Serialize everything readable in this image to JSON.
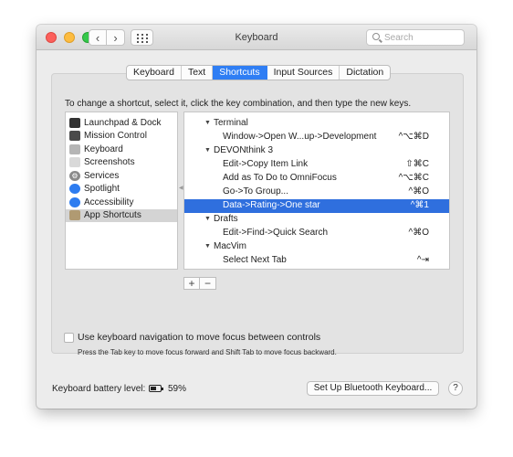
{
  "window": {
    "title": "Keyboard",
    "search_placeholder": "Search",
    "nav": {
      "back": "‹",
      "forward": "›"
    }
  },
  "tabs": [
    {
      "label": "Keyboard",
      "active": false
    },
    {
      "label": "Text",
      "active": false
    },
    {
      "label": "Shortcuts",
      "active": true
    },
    {
      "label": "Input Sources",
      "active": false
    },
    {
      "label": "Dictation",
      "active": false
    }
  ],
  "instruction": "To change a shortcut, select it, click the key combination, and then type the new keys.",
  "categories": [
    {
      "label": "Launchpad & Dock",
      "icon": "launchpad-icon",
      "color": "#333333"
    },
    {
      "label": "Mission Control",
      "icon": "mission-control-icon",
      "color": "#4a4a4a"
    },
    {
      "label": "Keyboard",
      "icon": "keyboard-icon",
      "color": "#b5b5b5"
    },
    {
      "label": "Screenshots",
      "icon": "screenshot-icon",
      "color": "#d9d9d9"
    },
    {
      "label": "Services",
      "icon": "gear-icon",
      "color": "#8a8a8a"
    },
    {
      "label": "Spotlight",
      "icon": "spotlight-icon",
      "color": "#2d7cf0"
    },
    {
      "label": "Accessibility",
      "icon": "accessibility-icon",
      "color": "#2d7cf0"
    },
    {
      "label": "App Shortcuts",
      "icon": "app-shortcuts-icon",
      "color": "#b09a72",
      "selected": true
    }
  ],
  "shortcuts": [
    {
      "type": "group",
      "label": "Terminal"
    },
    {
      "type": "item",
      "label": "Window->Open W...up->Development",
      "key": "^⌥⌘D"
    },
    {
      "type": "group",
      "label": "DEVONthink 3"
    },
    {
      "type": "item",
      "label": "Edit->Copy Item Link",
      "key": "⇧⌘C"
    },
    {
      "type": "item",
      "label": "Add as To Do to OmniFocus",
      "key": "^⌥⌘C"
    },
    {
      "type": "item",
      "label": "Go->To Group...",
      "key": "^⌘O"
    },
    {
      "type": "item",
      "label": "Data->Rating->One star",
      "key": "^⌘1",
      "selected": true
    },
    {
      "type": "group",
      "label": "Drafts"
    },
    {
      "type": "item",
      "label": "Edit->Find->Quick Search",
      "key": "^⌘O"
    },
    {
      "type": "group",
      "label": "MacVim"
    },
    {
      "type": "item",
      "label": "Select Next Tab",
      "key": "^⇥"
    }
  ],
  "list_buttons": {
    "add": "+",
    "remove": "−"
  },
  "keyboard_nav": {
    "label": "Use keyboard navigation to move focus between controls",
    "help": "Press the Tab key to move focus forward and Shift Tab to move focus backward.",
    "checked": false
  },
  "battery": {
    "label": "Keyboard battery level:",
    "percent_text": "59%",
    "level": 0.59
  },
  "bluetooth_button": "Set Up Bluetooth Keyboard...",
  "help_button": "?",
  "colors": {
    "accent": "#2f7ef4",
    "selection": "#2f6fde"
  }
}
